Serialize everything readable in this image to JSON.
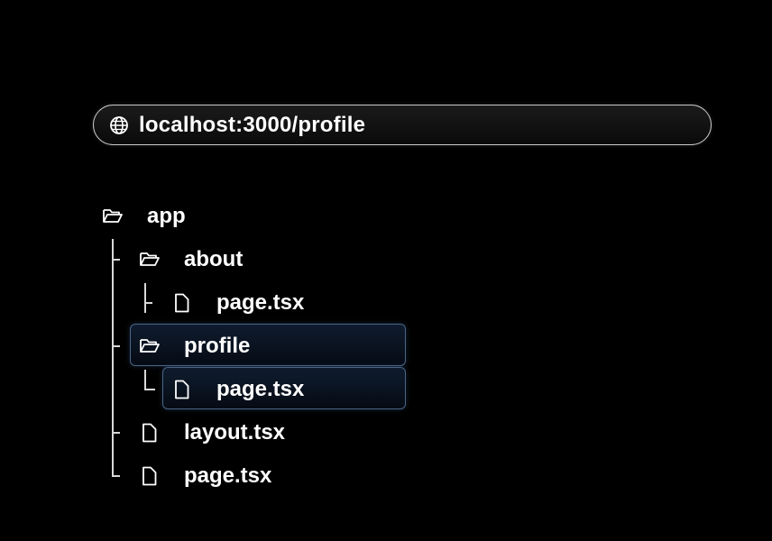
{
  "browser": {
    "url": "localhost:3000/profile",
    "url_icon": "globe-icon"
  },
  "tree": {
    "root": {
      "label": "app",
      "icon": "folder-open-icon"
    },
    "items": [
      {
        "label": "about",
        "icon": "folder-open-icon",
        "depth": 1,
        "highlighted": false
      },
      {
        "label": "page.tsx",
        "icon": "file-icon",
        "depth": 2,
        "highlighted": false
      },
      {
        "label": "profile",
        "icon": "folder-open-icon",
        "depth": 1,
        "highlighted": true
      },
      {
        "label": "page.tsx",
        "icon": "file-icon",
        "depth": 2,
        "highlighted": true
      },
      {
        "label": "layout.tsx",
        "icon": "file-icon",
        "depth": 1,
        "highlighted": false
      },
      {
        "label": "page.tsx",
        "icon": "file-icon",
        "depth": 1,
        "highlighted": false
      }
    ]
  },
  "colors": {
    "background": "#000000",
    "text": "#ffffff",
    "highlight_border": "#4a6485",
    "highlight_fill": "#0f1c2e"
  }
}
